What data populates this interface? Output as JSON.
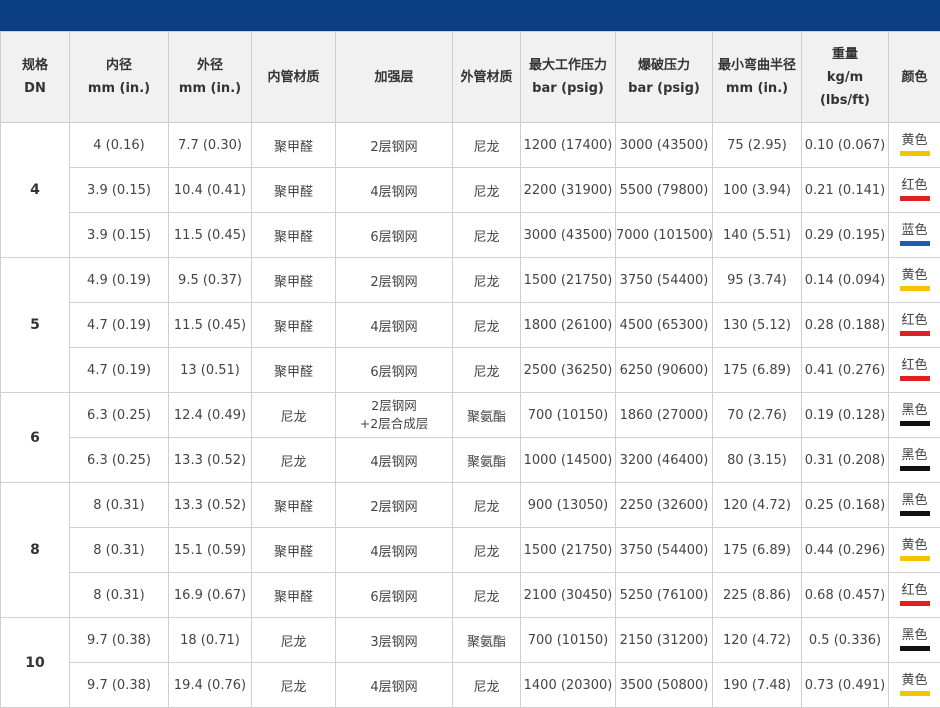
{
  "headers": [
    [
      "规格",
      "DN"
    ],
    [
      "内径",
      "mm (in.)"
    ],
    [
      "外径",
      "mm (in.)"
    ],
    [
      "内管材质"
    ],
    [
      "加强层"
    ],
    [
      "外管材质"
    ],
    [
      "最大工作压力",
      "bar (psig)"
    ],
    [
      "爆破压力",
      "bar (psig)"
    ],
    [
      "最小弯曲半径",
      "mm (in.)"
    ],
    [
      "重量",
      "kg/m",
      "(lbs/ft)"
    ],
    [
      "颜色"
    ]
  ],
  "colors": {
    "topbar": "#0a3d82",
    "yellow": "#f2c500",
    "red": "#e02020",
    "blue": "#1a5fb4",
    "black": "#111111"
  },
  "groups": [
    {
      "dn": "4",
      "rows": [
        {
          "id": "4 (0.16)",
          "od": "7.7 (0.30)",
          "inner": "聚甲醛",
          "reinf": [
            "2层钢网"
          ],
          "outer": "尼龙",
          "wp": "1200 (17400)",
          "bp": "3000 (43500)",
          "bend": "75 (2.95)",
          "weight": "0.10 (0.067)",
          "color": "黄色",
          "swatch": "yellow"
        },
        {
          "id": "3.9 (0.15)",
          "od": "10.4 (0.41)",
          "inner": "聚甲醛",
          "reinf": [
            "4层钢网"
          ],
          "outer": "尼龙",
          "wp": "2200 (31900)",
          "bp": "5500 (79800)",
          "bend": "100 (3.94)",
          "weight": "0.21 (0.141)",
          "color": "红色",
          "swatch": "red"
        },
        {
          "id": "3.9 (0.15)",
          "od": "11.5 (0.45)",
          "inner": "聚甲醛",
          "reinf": [
            "6层钢网"
          ],
          "outer": "尼龙",
          "wp": "3000 (43500)",
          "bp": "7000 (101500)",
          "bend": "140 (5.51)",
          "weight": "0.29 (0.195)",
          "color": "蓝色",
          "swatch": "blue"
        }
      ]
    },
    {
      "dn": "5",
      "rows": [
        {
          "id": "4.9 (0.19)",
          "od": "9.5 (0.37)",
          "inner": "聚甲醛",
          "reinf": [
            "2层钢网"
          ],
          "outer": "尼龙",
          "wp": "1500 (21750)",
          "bp": "3750 (54400)",
          "bend": "95 (3.74)",
          "weight": "0.14 (0.094)",
          "color": "黄色",
          "swatch": "yellow"
        },
        {
          "id": "4.7 (0.19)",
          "od": "11.5 (0.45)",
          "inner": "聚甲醛",
          "reinf": [
            "4层钢网"
          ],
          "outer": "尼龙",
          "wp": "1800 (26100)",
          "bp": "4500 (65300)",
          "bend": "130 (5.12)",
          "weight": "0.28 (0.188)",
          "color": "红色",
          "swatch": "red"
        },
        {
          "id": "4.7 (0.19)",
          "od": "13 (0.51)",
          "inner": "聚甲醛",
          "reinf": [
            "6层钢网"
          ],
          "outer": "尼龙",
          "wp": "2500 (36250)",
          "bp": "6250 (90600)",
          "bend": "175 (6.89)",
          "weight": "0.41 (0.276)",
          "color": "红色",
          "swatch": "red"
        }
      ]
    },
    {
      "dn": "6",
      "rows": [
        {
          "id": "6.3 (0.25)",
          "od": "12.4 (0.49)",
          "inner": "尼龙",
          "reinf": [
            "2层钢网",
            "+2层合成层"
          ],
          "outer": "聚氨酯",
          "wp": "700 (10150)",
          "bp": "1860 (27000)",
          "bend": "70 (2.76)",
          "weight": "0.19 (0.128)",
          "color": "黑色",
          "swatch": "black"
        },
        {
          "id": "6.3 (0.25)",
          "od": "13.3 (0.52)",
          "inner": "尼龙",
          "reinf": [
            "4层钢网"
          ],
          "outer": "聚氨酯",
          "wp": "1000 (14500)",
          "bp": "3200 (46400)",
          "bend": "80 (3.15)",
          "weight": "0.31 (0.208)",
          "color": "黑色",
          "swatch": "black"
        }
      ]
    },
    {
      "dn": "8",
      "rows": [
        {
          "id": "8 (0.31)",
          "od": "13.3 (0.52)",
          "inner": "聚甲醛",
          "reinf": [
            "2层钢网"
          ],
          "outer": "尼龙",
          "wp": "900 (13050)",
          "bp": "2250 (32600)",
          "bend": "120 (4.72)",
          "weight": "0.25 (0.168)",
          "color": "黑色",
          "swatch": "black"
        },
        {
          "id": "8 (0.31)",
          "od": "15.1 (0.59)",
          "inner": "聚甲醛",
          "reinf": [
            "4层钢网"
          ],
          "outer": "尼龙",
          "wp": "1500 (21750)",
          "bp": "3750 (54400)",
          "bend": "175 (6.89)",
          "weight": "0.44 (0.296)",
          "color": "黄色",
          "swatch": "yellow"
        },
        {
          "id": "8 (0.31)",
          "od": "16.9 (0.67)",
          "inner": "聚甲醛",
          "reinf": [
            "6层钢网"
          ],
          "outer": "尼龙",
          "wp": "2100 (30450)",
          "bp": "5250 (76100)",
          "bend": "225 (8.86)",
          "weight": "0.68 (0.457)",
          "color": "红色",
          "swatch": "red"
        }
      ]
    },
    {
      "dn": "10",
      "rows": [
        {
          "id": "9.7 (0.38)",
          "od": "18 (0.71)",
          "inner": "尼龙",
          "reinf": [
            "3层钢网"
          ],
          "outer": "聚氨酯",
          "wp": "700 (10150)",
          "bp": "2150 (31200)",
          "bend": "120 (4.72)",
          "weight": "0.5 (0.336)",
          "color": "黑色",
          "swatch": "black"
        },
        {
          "id": "9.7 (0.38)",
          "od": "19.4 (0.76)",
          "inner": "尼龙",
          "reinf": [
            "4层钢网"
          ],
          "outer": "尼龙",
          "wp": "1400 (20300)",
          "bp": "3500 (50800)",
          "bend": "190 (7.48)",
          "weight": "0.73 (0.491)",
          "color": "黄色",
          "swatch": "yellow"
        }
      ]
    }
  ]
}
